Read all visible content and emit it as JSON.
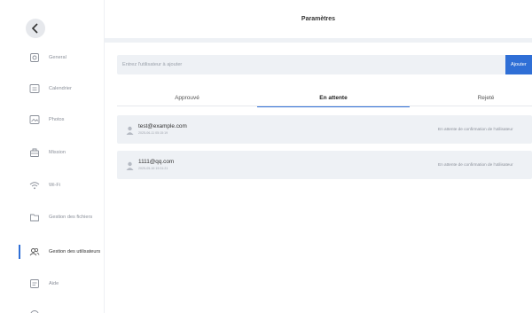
{
  "header": {
    "title": "Paramètres"
  },
  "sidebar": {
    "items": [
      {
        "label": "General",
        "icon": "general-settings-icon"
      },
      {
        "label": "Calendrier",
        "icon": "calendar-icon"
      },
      {
        "label": "Photos",
        "icon": "photos-icon"
      },
      {
        "label": "Mission",
        "icon": "mission-icon"
      },
      {
        "label": "Wi-Fi",
        "icon": "wifi-icon"
      },
      {
        "label": "Gestion des fichiers",
        "icon": "folder-icon"
      },
      {
        "label": "Gestion des utilisateurs",
        "icon": "users-icon",
        "active": true
      },
      {
        "label": "Aide",
        "icon": "help-icon"
      }
    ]
  },
  "add_user": {
    "placeholder": "Entrez l'utilisateur à ajouter",
    "button_label": "Ajouter"
  },
  "tabs": {
    "approved": "Approuvé",
    "pending": "En attente",
    "rejected": "Rejeté",
    "active": "pending"
  },
  "users": [
    {
      "email": "test@example.com",
      "date": "2025-06-11 05:15:19",
      "status": "En attente de confirmation de l'utilisateur"
    },
    {
      "email": "1111@qq.com",
      "date": "2025-05-16 19:31:21",
      "status": "En attente de confirmation de l'utilisateur"
    }
  ],
  "colors": {
    "accent": "#2f6fd6",
    "row_bg": "#eef1f5"
  }
}
